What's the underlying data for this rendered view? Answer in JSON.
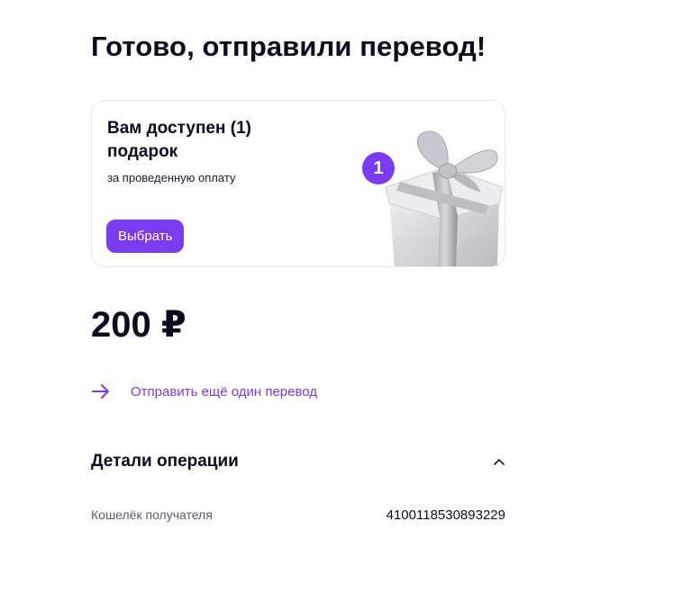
{
  "header": {
    "title": "Готово, отправили перевод!"
  },
  "gift_card": {
    "title": "Вам доступен (1) подарок",
    "subtitle": "за проведенную оплату",
    "button_label": "Выбрать",
    "badge_count": "1",
    "accent_color": "#7a3cf0"
  },
  "transfer": {
    "amount": "200 ₽"
  },
  "actions": {
    "send_again_label": "Отправить ещё один перевод",
    "send_again_icon": "arrow-right-icon"
  },
  "details": {
    "title": "Детали операции",
    "toggle_icon": "chevron-up-icon",
    "rows": [
      {
        "label": "Кошелёк получателя",
        "value": "4100118530893229"
      }
    ]
  }
}
